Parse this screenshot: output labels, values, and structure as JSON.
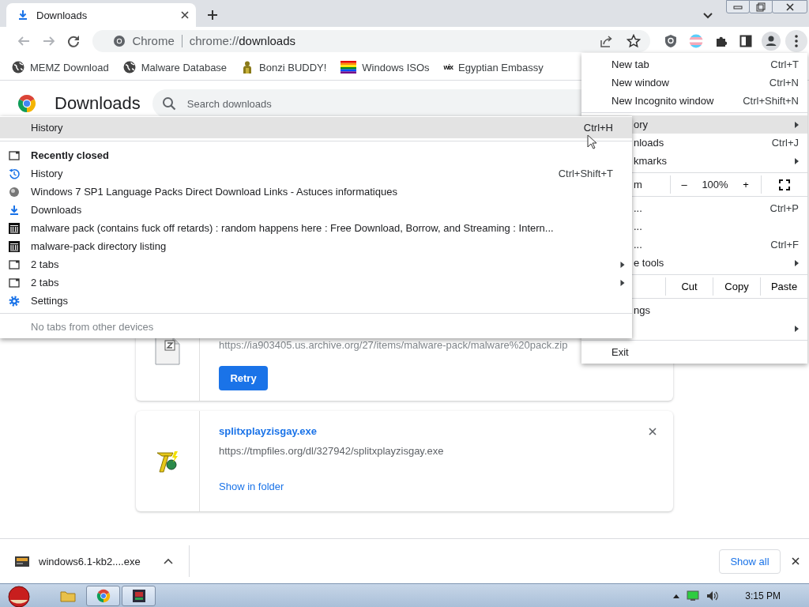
{
  "tabs": [
    {
      "title": "Downloads",
      "selected": true
    }
  ],
  "address_bar": {
    "chip": "Chrome",
    "scheme": "chrome://",
    "path": "downloads"
  },
  "bookmarks": [
    {
      "label": "MEMZ Download",
      "kind": "globe"
    },
    {
      "label": "Malware Database",
      "kind": "globe"
    },
    {
      "label": "Bonzi BUDDY!",
      "kind": "figure"
    },
    {
      "label": "Windows ISOs",
      "kind": "rainbow"
    },
    {
      "label": "Egyptian Embassy",
      "kind": "wix",
      "icon_text": "wix"
    }
  ],
  "page": {
    "title": "Downloads",
    "search_placeholder": "Search downloads"
  },
  "downloads": [
    {
      "kind": "failed",
      "url": "https://ia903405.us.archive.org/27/items/malware-pack/malware%20pack.zip",
      "action": "Retry"
    },
    {
      "kind": "complete",
      "file": "splitxplayzisgay.exe",
      "url": "https://tmpfiles.org/dl/327942/splitxplayzisgay.exe",
      "action": "Show in folder"
    }
  ],
  "app_menu": {
    "groups": [
      [
        {
          "kind": "item",
          "label": "New tab",
          "shortcut": "Ctrl+T",
          "covered": false,
          "submenu": false,
          "selected": false
        },
        {
          "kind": "item",
          "label": "New window",
          "shortcut": "Ctrl+N",
          "covered": false,
          "submenu": false,
          "selected": false
        },
        {
          "kind": "item",
          "label": "New Incognito window",
          "shortcut": "Ctrl+Shift+N",
          "covered": false,
          "submenu": false,
          "selected": false
        }
      ],
      [
        {
          "kind": "item",
          "label": "ory",
          "covered": true,
          "submenu": true,
          "selected": true
        },
        {
          "kind": "item",
          "label": "nloads",
          "shortcut": "Ctrl+J",
          "covered": true,
          "submenu": false,
          "selected": false
        },
        {
          "kind": "item",
          "label": "kmarks",
          "covered": true,
          "submenu": true,
          "selected": false
        }
      ],
      [
        {
          "kind": "zoom",
          "label": "m",
          "minus": "–",
          "reading": "100%",
          "plus": "+"
        }
      ],
      [
        {
          "kind": "item",
          "label": "...",
          "shortcut": "Ctrl+P",
          "covered": true,
          "submenu": false,
          "selected": false
        },
        {
          "kind": "item",
          "label": "...",
          "covered": true,
          "submenu": false,
          "selected": false
        },
        {
          "kind": "item",
          "label": "...",
          "shortcut": "Ctrl+F",
          "covered": true,
          "submenu": false,
          "selected": false
        },
        {
          "kind": "item",
          "label": "e tools",
          "covered": true,
          "submenu": true,
          "selected": false
        }
      ],
      [
        {
          "kind": "edit",
          "buttons": [
            "Cut",
            "Copy",
            "Paste"
          ]
        }
      ],
      [
        {
          "kind": "item",
          "label": "ngs",
          "covered": true,
          "submenu": false,
          "selected": false
        },
        {
          "kind": "item",
          "covered": true,
          "submenu": true,
          "selected": false
        }
      ],
      [
        {
          "kind": "item",
          "label": "Exit",
          "covered": false,
          "submenu": false,
          "selected": false
        }
      ]
    ]
  },
  "history_menu": {
    "header": {
      "label": "History",
      "shortcut": "Ctrl+H",
      "selected": true
    },
    "items": [
      {
        "kind": "window",
        "label": "Recently closed",
        "bold": true,
        "submenu": false,
        "selected": false
      },
      {
        "kind": "history",
        "label": "History",
        "shortcut": "Ctrl+Shift+T",
        "bold": false,
        "submenu": false,
        "selected": false
      },
      {
        "kind": "site",
        "label": "Windows 7 SP1 Language Packs Direct Download Links - Astuces informatiques",
        "bold": false,
        "submenu": false,
        "selected": false
      },
      {
        "kind": "download",
        "label": "Downloads",
        "bold": false,
        "submenu": false,
        "selected": false
      },
      {
        "kind": "archive",
        "label": "malware pack (contains fuck off retards) : random happens here : Free Download, Borrow, and Streaming : Intern...",
        "bold": false,
        "submenu": false,
        "selected": false
      },
      {
        "kind": "archive",
        "label": "malware-pack directory listing",
        "bold": false,
        "submenu": false,
        "selected": false
      },
      {
        "kind": "window",
        "label": "2 tabs",
        "bold": false,
        "submenu": true,
        "selected": false
      },
      {
        "kind": "window",
        "label": "2 tabs",
        "bold": false,
        "submenu": true,
        "selected": false
      },
      {
        "kind": "gear",
        "label": "Settings",
        "bold": false,
        "submenu": false,
        "selected": false
      }
    ],
    "footer": "No tabs from other devices"
  },
  "shelf": {
    "file": "windows6.1-kb2....exe",
    "button": "Show all"
  },
  "taskbar": {
    "clock": "3:15 PM"
  }
}
